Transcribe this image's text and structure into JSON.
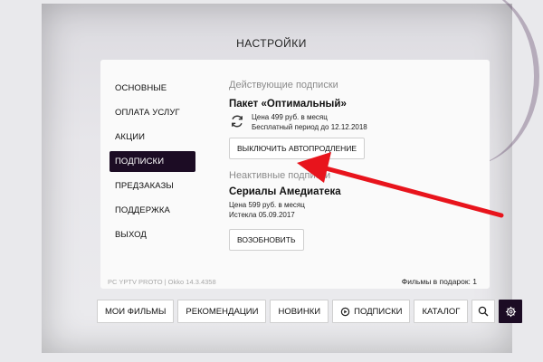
{
  "header": {
    "title": "НАСТРОЙКИ"
  },
  "menu": {
    "items": [
      {
        "label": "ОСНОВНЫЕ"
      },
      {
        "label": "ОПЛАТА УСЛУГ"
      },
      {
        "label": "АКЦИИ"
      },
      {
        "label": "ПОДПИСКИ",
        "active": true
      },
      {
        "label": "ПРЕДЗАКАЗЫ"
      },
      {
        "label": "ПОДДЕРЖКА"
      },
      {
        "label": "ВЫХОД"
      }
    ]
  },
  "active_subscriptions": {
    "title": "Действующие подписки",
    "plan_name": "Пакет «Оптимальный»",
    "price": "Цена 499 руб. в месяц",
    "trial": "Бесплатный период до 12.12.2018",
    "button": "ВЫКЛЮЧИТЬ АВТОПРОДЛЕНИЕ"
  },
  "inactive_subscriptions": {
    "title": "Неактивные подписки",
    "plan_name": "Сериалы Амедиатека",
    "price": "Цена 599 руб. в месяц",
    "expired": "Истекла 05.09.2017",
    "button": "ВОЗОБНОВИТЬ"
  },
  "footer": {
    "version": "PC YPTV PROTO | Okko 14.3.4358",
    "gift_films": "Фильмы в подарок: 1"
  },
  "nav": {
    "my_films": "МОИ ФИЛЬМЫ",
    "recommendations": "РЕКОМЕНДАЦИИ",
    "new": "НОВИНКИ",
    "subscriptions": "ПОДПИСКИ",
    "catalog": "КАТАЛОГ"
  },
  "icons": {
    "refresh": "refresh-icon",
    "search": "search-icon",
    "settings": "gear-icon",
    "subscriptions": "subscriptions-icon"
  },
  "colors": {
    "accent_dark": "#1c0c24",
    "annotation_arrow": "#e8141c"
  }
}
